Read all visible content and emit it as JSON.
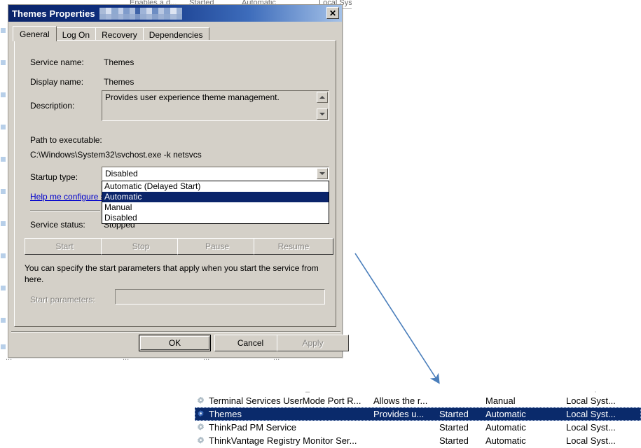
{
  "background": {
    "top_row_fragments": [
      "Enables a d...",
      "Started",
      "Automatic",
      "Local System"
    ],
    "bottom_row_fragments": [
      "...",
      "...",
      "...",
      "..."
    ]
  },
  "dialog": {
    "title": "Themes Properties",
    "close_label": "✕",
    "tabs": [
      {
        "label": "General",
        "active": true
      },
      {
        "label": "Log On",
        "active": false
      },
      {
        "label": "Recovery",
        "active": false
      },
      {
        "label": "Dependencies",
        "active": false
      }
    ],
    "general": {
      "service_name_label": "Service name:",
      "service_name_value": "Themes",
      "display_name_label": "Display name:",
      "display_name_value": "Themes",
      "description_label": "Description:",
      "description_value": "Provides user experience theme management.",
      "path_label": "Path to executable:",
      "path_value": "C:\\Windows\\System32\\svchost.exe -k netsvcs",
      "startup_type_label": "Startup type:",
      "startup_type_value": "Disabled",
      "startup_type_options": [
        "Automatic (Delayed Start)",
        "Automatic",
        "Manual",
        "Disabled"
      ],
      "startup_type_highlighted": "Automatic",
      "help_link": "Help me configure s",
      "service_status_label": "Service status:",
      "service_status_value": "Stopped",
      "buttons": [
        {
          "label": "Start",
          "enabled": false
        },
        {
          "label": "Stop",
          "enabled": false
        },
        {
          "label": "Pause",
          "enabled": false
        },
        {
          "label": "Resume",
          "enabled": false
        }
      ],
      "start_params_help": "You can specify the start parameters that apply when you start the service from here.",
      "start_params_label": "Start parameters:",
      "start_params_value": ""
    },
    "footer": {
      "ok_label": "OK",
      "cancel_label": "Cancel",
      "apply_label": "Apply"
    }
  },
  "services_list": {
    "rows": [
      {
        "name": "Terminal Services UserMode Port R...",
        "description": "Allows the r...",
        "status": "",
        "startup_type": "Manual",
        "log_on_as": "Local Syst...",
        "selected": false
      },
      {
        "name": "Themes",
        "description": "Provides u...",
        "status": "Started",
        "startup_type": "Automatic",
        "log_on_as": "Local Syst...",
        "selected": true
      },
      {
        "name": "ThinkPad PM Service",
        "description": "",
        "status": "Started",
        "startup_type": "Automatic",
        "log_on_as": "Local Syst...",
        "selected": false
      },
      {
        "name": "ThinkVantage Registry Monitor Ser...",
        "description": "",
        "status": "Started",
        "startup_type": "Automatic",
        "log_on_as": "Local Syst...",
        "selected": false
      }
    ]
  },
  "annotation": {
    "type": "arrow",
    "color": "#4a7ebb",
    "from": "dialog",
    "to": "themes-row"
  },
  "colors": {
    "dialog_face": "#d4d0c8",
    "titlebar_start": "#0a246a",
    "titlebar_end": "#a5c2e8",
    "selection": "#0a2a6b",
    "link": "#0000cc",
    "annotation": "#4a7ebb"
  }
}
